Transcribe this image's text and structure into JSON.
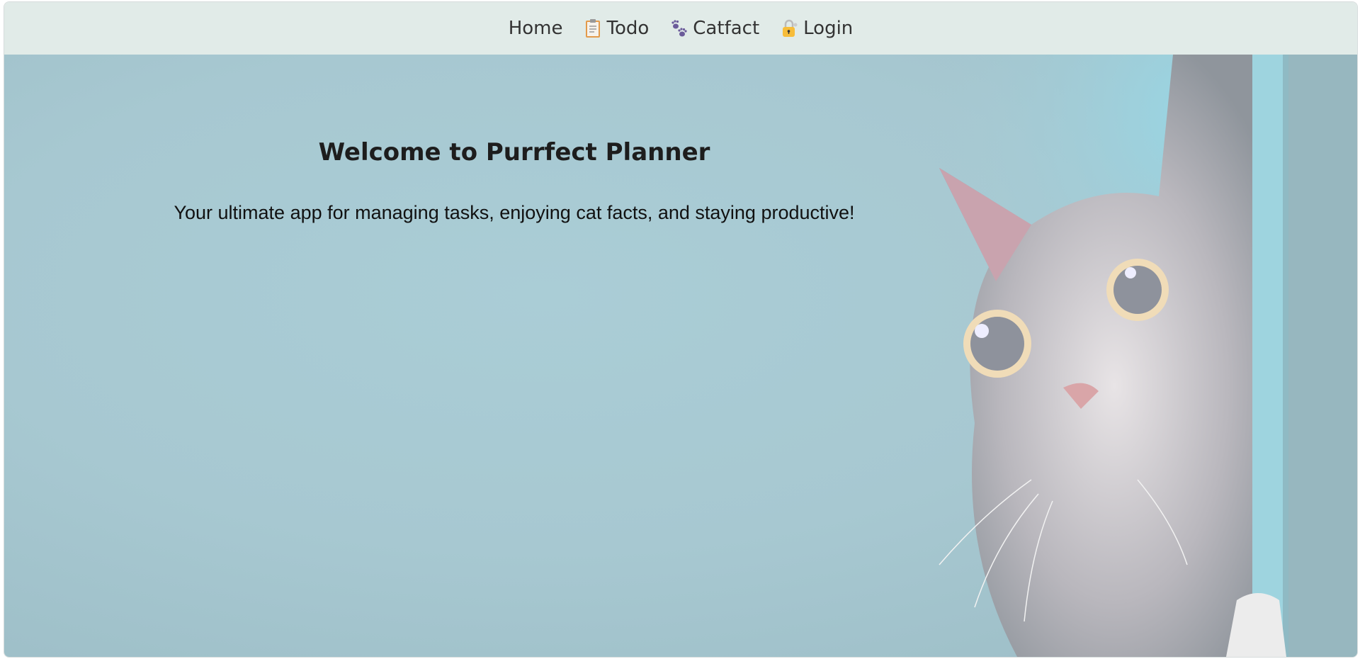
{
  "nav": {
    "items": [
      {
        "label": "Home",
        "icon": ""
      },
      {
        "label": "Todo",
        "icon": "clipboard-icon"
      },
      {
        "label": "Catfact",
        "icon": "paw-prints-icon"
      },
      {
        "label": "Login",
        "icon": "lock-with-key-icon"
      }
    ]
  },
  "hero": {
    "title": "Welcome to Purrfect Planner",
    "subtitle": "Your ultimate app for managing tasks, enjoying cat facts, and staying productive!",
    "background_color": "#a9cad3"
  }
}
